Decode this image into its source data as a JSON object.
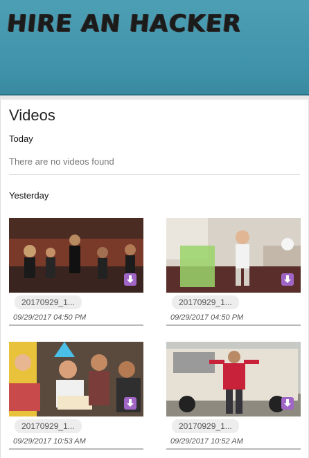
{
  "header": {
    "logo_text": "HIRE AN HACKER",
    "bg_color": "#4399ae"
  },
  "page": {
    "title": "Videos"
  },
  "sections": {
    "today": {
      "label": "Today",
      "empty_message": "There are no videos found"
    },
    "yesterday": {
      "label": "Yesterday"
    }
  },
  "videos": [
    {
      "name": "20170929_1...",
      "date": "09/29/2017 04:50 PM",
      "icon": "download-icon"
    },
    {
      "name": "20170929_1...",
      "date": "09/29/2017 04:50 PM",
      "icon": "download-icon"
    },
    {
      "name": "20170929_1...",
      "date": "09/29/2017 10:53 AM",
      "icon": "download-icon"
    },
    {
      "name": "20170929_1...",
      "date": "09/29/2017 10:52 AM",
      "icon": "download-icon"
    }
  ],
  "colors": {
    "accent": "#a066c6",
    "divider": "#d9d9d9"
  }
}
